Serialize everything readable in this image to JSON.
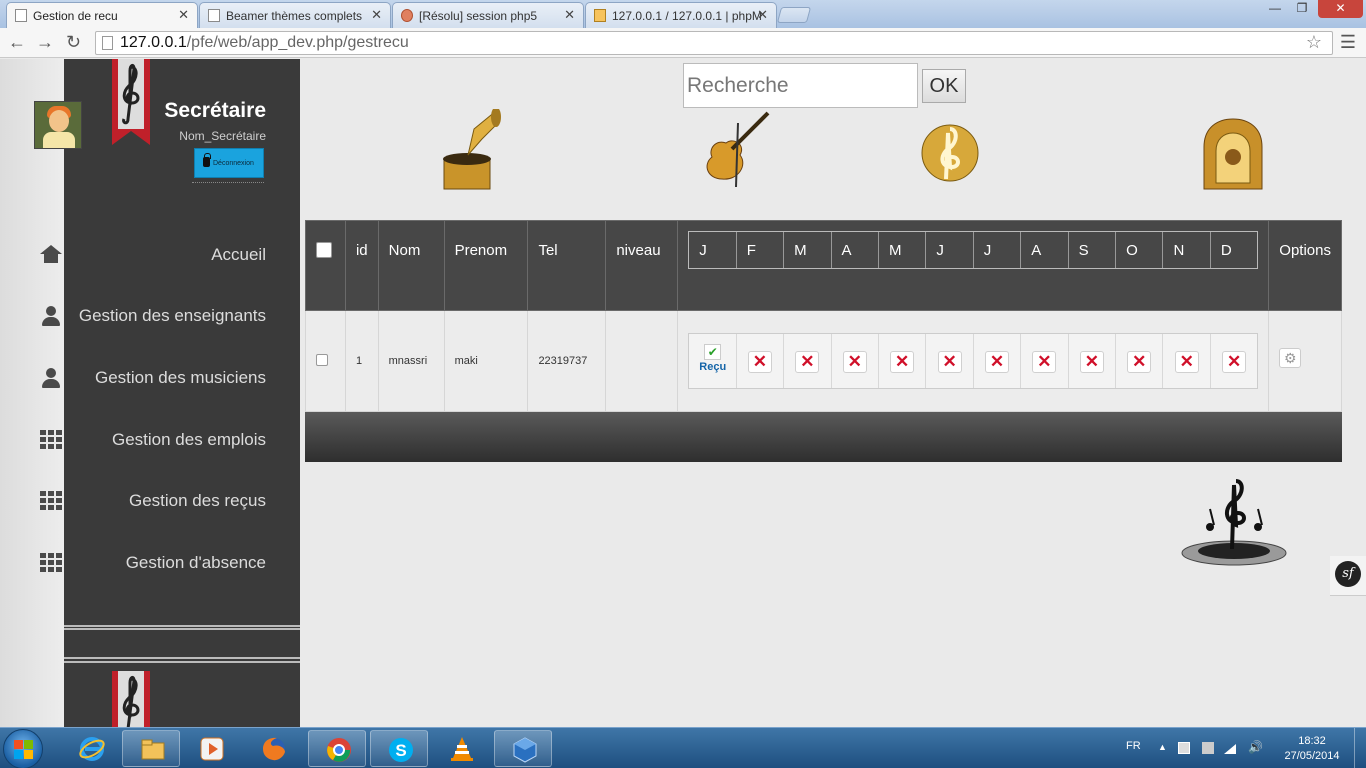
{
  "browser": {
    "tabs": [
      {
        "title": "Gestion de recu",
        "active": true
      },
      {
        "title": "Beamer thèmes complets",
        "active": false
      },
      {
        "title": "[Résolu] session php5",
        "active": false
      },
      {
        "title": "127.0.0.1 / 127.0.0.1 | phpM",
        "active": false
      }
    ],
    "url_host": "127.0.0.1",
    "url_path": "/pfe/web/app_dev.php/gestrecu",
    "window_controls": {
      "minimize": "—",
      "maximize": "❐",
      "close": "✕"
    }
  },
  "sidebar": {
    "profile_title": "Secrétaire",
    "profile_subtitle": "Nom_Secrétaire",
    "logout_label": "Déconnexion",
    "items": [
      {
        "label": "Accueil",
        "icon": "home-icon"
      },
      {
        "label": "Gestion des enseignants",
        "icon": "user-icon"
      },
      {
        "label": "Gestion des musiciens",
        "icon": "user-icon"
      },
      {
        "label": "Gestion des emplois",
        "icon": "grid-icon"
      },
      {
        "label": "Gestion des reçus",
        "icon": "grid-icon"
      },
      {
        "label": "Gestion d'absence",
        "icon": "grid-icon"
      }
    ]
  },
  "search": {
    "placeholder": "Recherche",
    "button_label": "OK"
  },
  "table": {
    "headers": {
      "id": "id",
      "nom": "Nom",
      "prenom": "Prenom",
      "tel": "Tel",
      "niveau": "niveau",
      "options": "Options"
    },
    "months": [
      "J",
      "F",
      "M",
      "A",
      "M",
      "J",
      "J",
      "A",
      "S",
      "O",
      "N",
      "D"
    ],
    "rows": [
      {
        "id": "1",
        "nom": "mnassri",
        "prenom": "maki",
        "tel": "22319737",
        "niveau": "",
        "recu_label": "Reçu",
        "month_status": [
          "paid",
          "unpaid",
          "unpaid",
          "unpaid",
          "unpaid",
          "unpaid",
          "unpaid",
          "unpaid",
          "unpaid",
          "unpaid",
          "unpaid",
          "unpaid"
        ]
      }
    ]
  },
  "symfony_badge": "sf",
  "taskbar": {
    "apps": [
      "internet-explorer-icon",
      "file-explorer-icon",
      "media-player-icon",
      "firefox-icon",
      "chrome-icon",
      "skype-icon",
      "vlc-icon",
      "virtualbox-icon"
    ],
    "language": "FR",
    "time": "18:32",
    "date": "27/05/2014"
  },
  "colors": {
    "sidebar_bg": "#3a3a3a",
    "table_header_bg": "#474747",
    "logout_btn": "#1aa3de",
    "taskbar": "#2a5f94",
    "unpaid_x": "#d0102a",
    "paid_check": "#2aa02a"
  }
}
